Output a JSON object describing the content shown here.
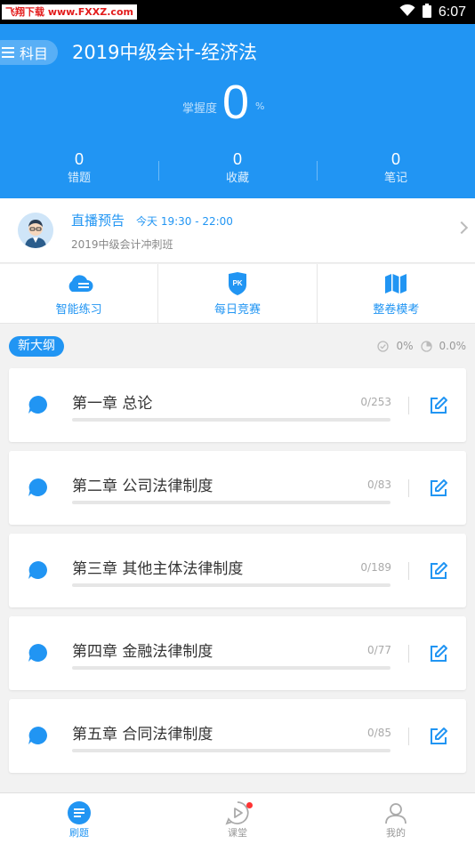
{
  "status_bar": {
    "source_tag": "飞翔下载 www.FXXZ.com",
    "time": "6:07"
  },
  "header": {
    "subject_button": "科目",
    "title": "2019中级会计-经济法",
    "mastery_label": "掌握度",
    "mastery_value": "0",
    "mastery_unit": "%",
    "stats": [
      {
        "value": "0",
        "label": "错题"
      },
      {
        "value": "0",
        "label": "收藏"
      },
      {
        "value": "0",
        "label": "笔记"
      }
    ]
  },
  "live": {
    "title": "直播预告",
    "time": "今天 19:30 - 22:00",
    "course": "2019中级会计冲刺班"
  },
  "quick_actions": [
    {
      "label": "智能练习",
      "icon": "cloud-icon"
    },
    {
      "label": "每日竞赛",
      "icon": "pk-shield-icon"
    },
    {
      "label": "整卷模考",
      "icon": "map-icon"
    }
  ],
  "outline": {
    "tag": "新大纲",
    "correct_rate": "0%",
    "progress_rate": "0.0%"
  },
  "chapters": [
    {
      "title": "第一章 总论",
      "count": "0/253",
      "progress": 0
    },
    {
      "title": "第二章 公司法律制度",
      "count": "0/83",
      "progress": 0
    },
    {
      "title": "第三章 其他主体法律制度",
      "count": "0/189",
      "progress": 0
    },
    {
      "title": "第四章 金融法律制度",
      "count": "0/77",
      "progress": 0
    },
    {
      "title": "第五章 合同法律制度",
      "count": "0/85",
      "progress": 0
    }
  ],
  "tabs": [
    {
      "label": "刷题",
      "active": true
    },
    {
      "label": "课堂",
      "active": false
    },
    {
      "label": "我的",
      "active": false
    }
  ],
  "colors": {
    "primary": "#2195f3",
    "background": "#f2f2f2"
  }
}
